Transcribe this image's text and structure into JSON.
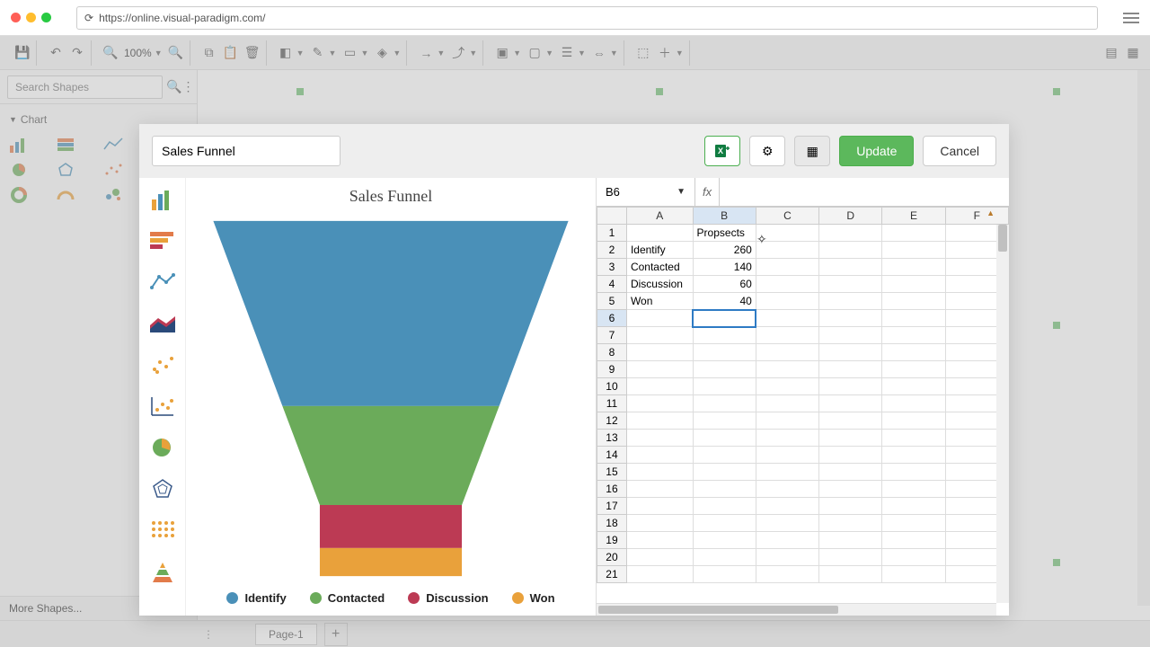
{
  "browser": {
    "url": "https://online.visual-paradigm.com/"
  },
  "toolbar": {
    "zoom": "100%"
  },
  "left_panel": {
    "search_placeholder": "Search Shapes",
    "section_title": "Chart",
    "more_shapes": "More Shapes..."
  },
  "footer": {
    "page_tab": "Page-1"
  },
  "modal": {
    "name": "Sales Funnel",
    "update": "Update",
    "cancel": "Cancel",
    "cell_ref": "B6",
    "fx": "fx",
    "columns": [
      "A",
      "B",
      "C",
      "D",
      "E",
      "F"
    ],
    "rows_visible": 21,
    "colors": {
      "identify": "#4a90b8",
      "contacted": "#6bab5a",
      "discussion": "#bc3a54",
      "won": "#e9a13b"
    }
  },
  "chart_data": {
    "type": "funnel",
    "title": "Sales Funnel",
    "series_name": "Propsects",
    "categories": [
      "Identify",
      "Contacted",
      "Discussion",
      "Won"
    ],
    "values": [
      260,
      140,
      60,
      40
    ],
    "colors": [
      "#4a90b8",
      "#6bab5a",
      "#bc3a54",
      "#e9a13b"
    ]
  }
}
